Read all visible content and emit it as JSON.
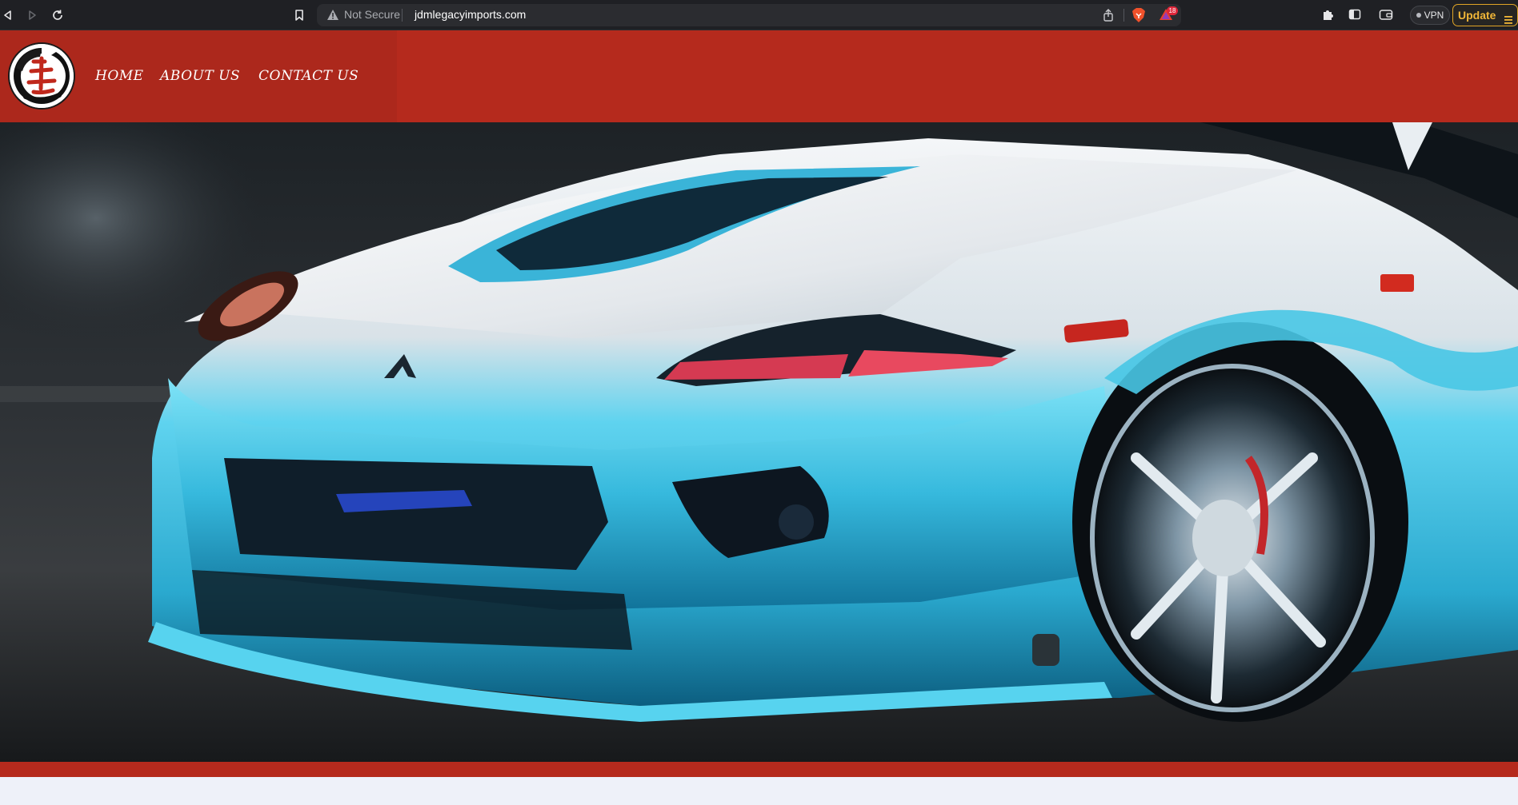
{
  "browser": {
    "security_label": "Not Secure",
    "url": "jdmlegacyimports.com",
    "rewards_count": "18",
    "vpn_label": "VPN",
    "update_label": "Update"
  },
  "site": {
    "nav": [
      {
        "label": "HOME"
      },
      {
        "label": "ABOUT US"
      },
      {
        "label": "CONTACT US"
      }
    ]
  },
  "colors": {
    "header_red": "#b52a1d",
    "header_box_red": "#ac281c",
    "car_cyan": "#38c8e8",
    "page_bg": "#eef1f9"
  },
  "icons": {
    "back": "triangle-left-icon",
    "forward": "triangle-right-icon",
    "reload": "reload-icon",
    "bookmark": "bookmark-icon",
    "warning": "warning-icon",
    "share": "share-icon",
    "brave": "brave-lion-icon",
    "rewards": "rewards-triangle-icon",
    "extensions": "puzzle-icon",
    "sidebar": "sidebar-icon",
    "wallet": "wallet-icon",
    "menu": "hamburger-icon"
  }
}
